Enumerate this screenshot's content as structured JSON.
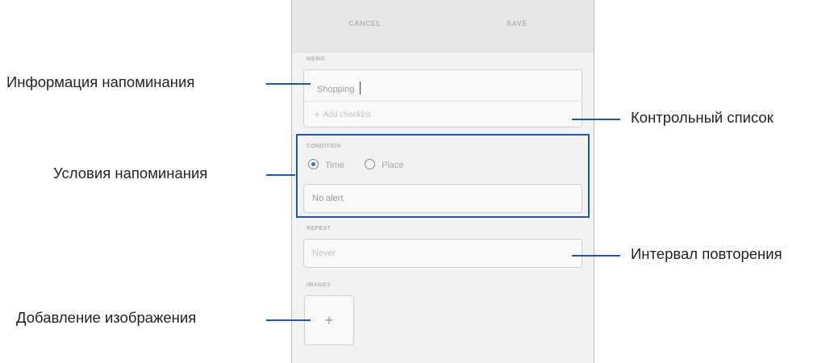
{
  "toolbar": {
    "cancel_label": "CANCEL",
    "save_label": "SAVE"
  },
  "memo": {
    "section_label": "MEMO",
    "text": "Shopping",
    "checklist_label": "Add checklist"
  },
  "condition": {
    "section_label": "CONDITION",
    "options": [
      {
        "label": "Time",
        "selected": true
      },
      {
        "label": "Place",
        "selected": false
      }
    ],
    "alert_value": "No alert"
  },
  "repeat": {
    "section_label": "REPEAT",
    "placeholder": "Never"
  },
  "images": {
    "section_label": "IMAGES",
    "add_symbol": "+"
  },
  "callouts": {
    "memo_info": "Информация напоминания",
    "conditions": "Условия напоминания",
    "add_image": "Добавление изображения",
    "checklist": "Контрольный список",
    "repeat_interval": "Интервал повторения"
  },
  "colors": {
    "accent": "#1c57a8",
    "radio_selected": "#4a6fa5",
    "panel_bg": "#f2f2f2"
  }
}
